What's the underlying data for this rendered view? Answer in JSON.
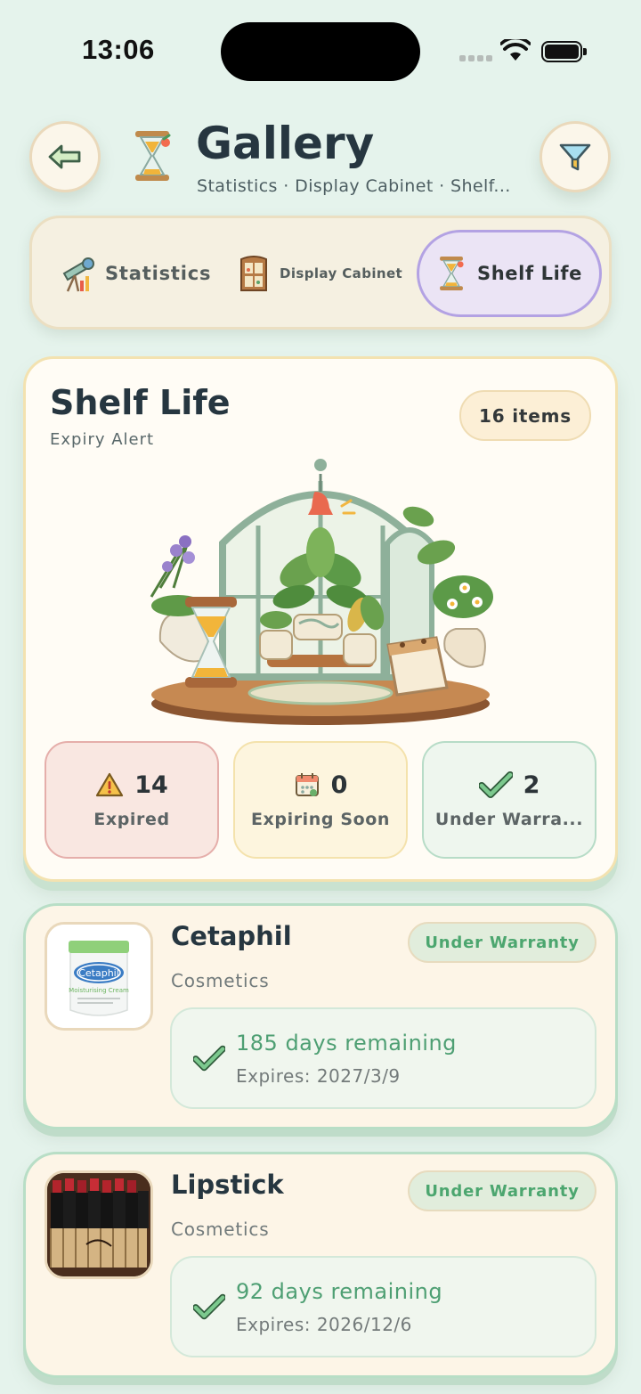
{
  "status_bar": {
    "time": "13:06"
  },
  "header": {
    "title": "Gallery",
    "subtitle": "Statistics · Display Cabinet · Shelf..."
  },
  "tabs": [
    {
      "label": "Statistics",
      "icon": "telescope-icon",
      "selected": false
    },
    {
      "label": "Display Cabinet",
      "icon": "cabinet-icon",
      "selected": false
    },
    {
      "label": "Shelf Life",
      "icon": "hourglass-icon",
      "selected": true
    }
  ],
  "shelf_life": {
    "title": "Shelf Life",
    "subtitle": "Expiry Alert",
    "count_label": "16 items",
    "stats": [
      {
        "value": "14",
        "label": "Expired",
        "icon": "warning-icon"
      },
      {
        "value": "0",
        "label": "Expiring Soon",
        "icon": "calendar-icon"
      },
      {
        "value": "2",
        "label": "Under Warra...",
        "icon": "checkmark-icon"
      }
    ]
  },
  "items": [
    {
      "name": "Cetaphil",
      "category": "Cosmetics",
      "status": "Under Warranty",
      "days_remaining": "185 days remaining",
      "expires": "Expires: 2027/3/9",
      "thumb_brand": "Cetaphil",
      "thumb_product": "Moisturising Cream"
    },
    {
      "name": "Lipstick",
      "category": "Cosmetics",
      "status": "Under Warranty",
      "days_remaining": "92 days remaining",
      "expires": "Expires: 2026/12/6"
    }
  ],
  "colors": {
    "background": "#e5f3ec",
    "accent_purple": "#b3a2e3",
    "warranty_green": "#4ca66f",
    "expired_red": "#e5aeaa"
  }
}
